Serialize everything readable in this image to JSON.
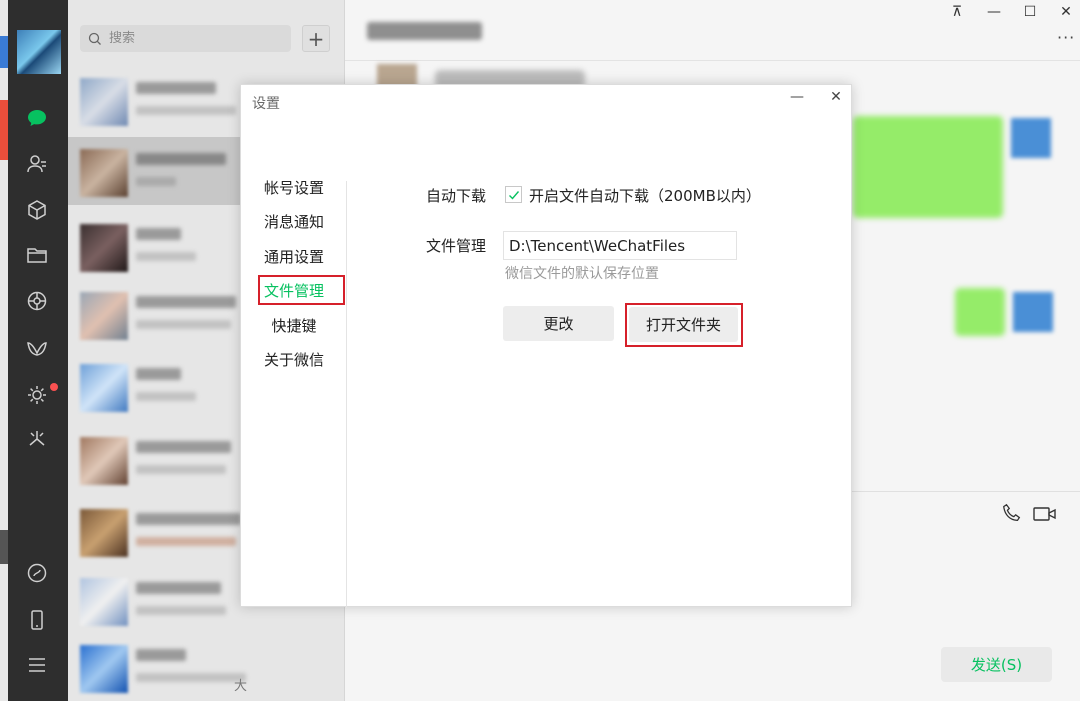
{
  "search": {
    "placeholder": "搜索",
    "add_label": "+"
  },
  "chat_list_action_label": "大",
  "window_controls": {
    "pin": "⊼",
    "minimize": "—",
    "maximize": "☐",
    "close": "✕",
    "more": "···"
  },
  "settings": {
    "title": "设置",
    "menu": [
      {
        "label": "帐号设置",
        "active": false
      },
      {
        "label": "消息通知",
        "active": false
      },
      {
        "label": "通用设置",
        "active": false
      },
      {
        "label": "文件管理",
        "active": true
      },
      {
        "label": "快捷键",
        "active": false
      },
      {
        "label": "关于微信",
        "active": false
      }
    ],
    "auto_download": {
      "label": "自动下载",
      "checked": true,
      "option_text": "开启文件自动下载（200MB以内）"
    },
    "file_management": {
      "label": "文件管理",
      "path_value": "D:\\Tencent\\WeChatFiles",
      "hint": "微信文件的默认保存位置",
      "change_button": "更改",
      "open_folder_button": "打开文件夹"
    },
    "minimize_glyph": "—",
    "close_glyph": "✕"
  },
  "chat": {
    "send_label": "发送(S)"
  },
  "colors": {
    "accent": "#07c160",
    "nav_bg": "#2e2e2e",
    "highlight": "#d6202a",
    "bubble": "#95ec69"
  },
  "nav_icons": [
    "chat-icon",
    "contacts-icon",
    "favorites-icon",
    "files-icon",
    "moments-icon",
    "channels-icon",
    "search-network-icon",
    "mini-program-icon",
    "mini-programs-link-icon",
    "phone-icon",
    "menu-icon"
  ]
}
